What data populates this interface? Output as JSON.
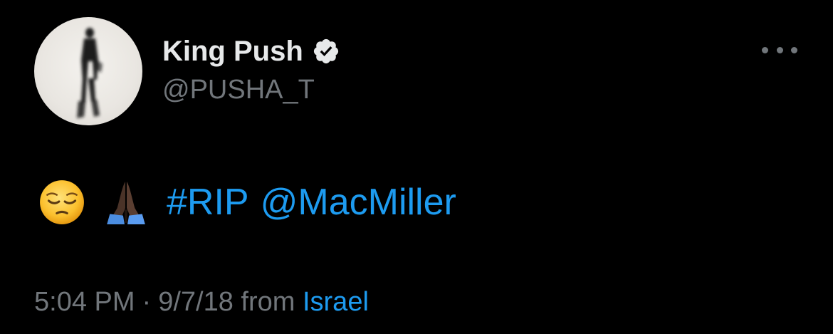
{
  "tweet": {
    "author": {
      "display_name": "King Push",
      "handle": "@PUSHA_T",
      "verified": true,
      "avatar_icon": "profile-photo"
    },
    "more_icon": "more-options-icon",
    "body": {
      "emoji_1": "pensive-face-emoji",
      "emoji_2": "folded-hands-emoji",
      "hashtag": "#RIP",
      "mention": "@MacMiller"
    },
    "meta": {
      "time": "5:04 PM",
      "separator": "·",
      "date": "9/7/18",
      "from_label": "from",
      "location": "Israel"
    }
  },
  "colors": {
    "background": "#000000",
    "text_primary": "#e7e9ea",
    "text_secondary": "#71767b",
    "link": "#1d9bf0",
    "verified_badge": "#e7e9ea"
  }
}
